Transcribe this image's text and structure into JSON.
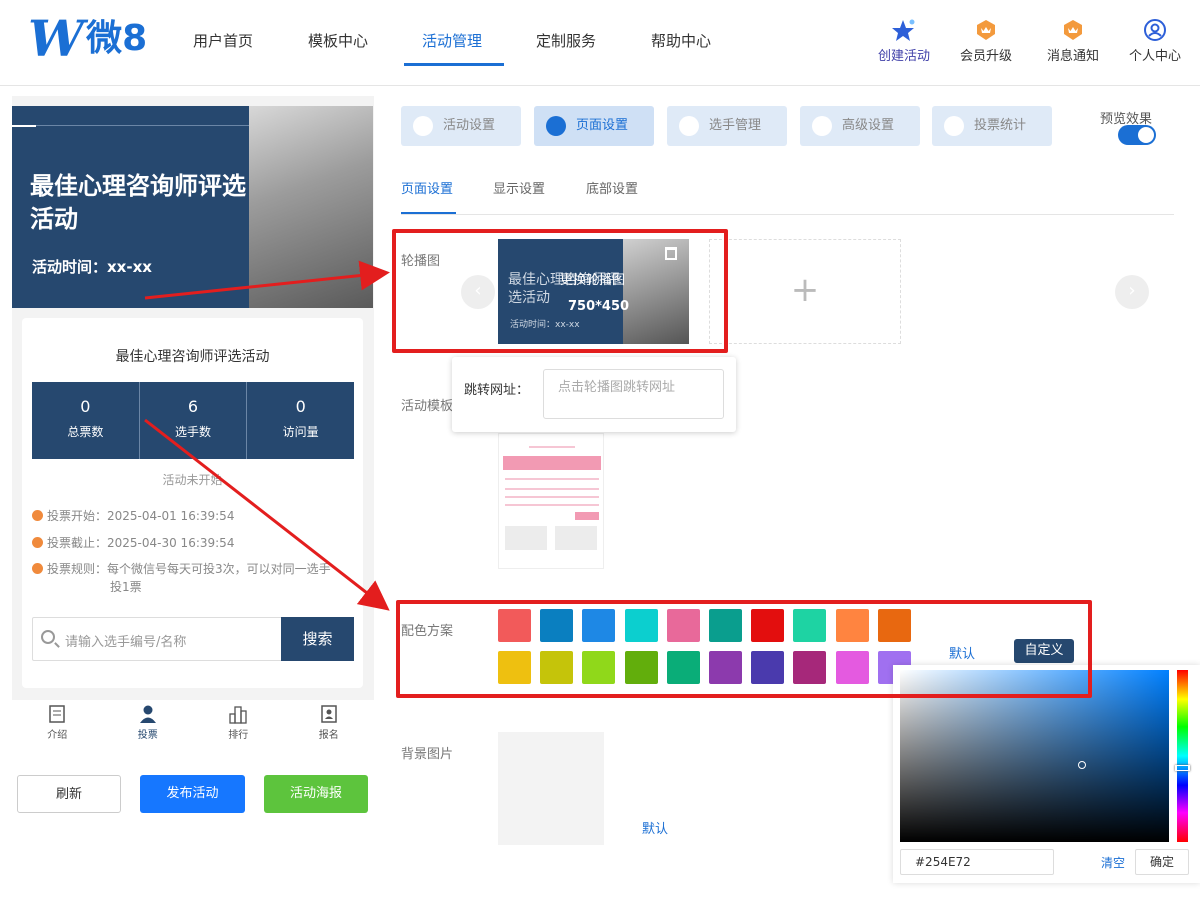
{
  "header": {
    "logo_text": "微8",
    "nav": [
      "用户首页",
      "模板中心",
      "活动管理",
      "定制服务",
      "帮助中心"
    ],
    "right_nav": [
      "创建活动",
      "会员升级",
      "消息通知",
      "个人中心"
    ]
  },
  "preview": {
    "banner_title": "最佳心理咨询师评选活动",
    "banner_time": "活动时间：xx-xx",
    "card_title": "最佳心理咨询师评选活动",
    "stats": [
      {
        "value": "0",
        "label": "总票数"
      },
      {
        "value": "6",
        "label": "选手数"
      },
      {
        "value": "0",
        "label": "访问量"
      }
    ],
    "status": "活动未开始",
    "vote_start": "投票开始：2025-04-01 16:39:54",
    "vote_end": "投票截止：2025-04-30 16:39:54",
    "vote_rule_1": "投票规则：每个微信号每天可投3次，可以对同一选手",
    "vote_rule_2": "投1票",
    "search_placeholder": "请输入选手编号/名称",
    "search_button": "搜索",
    "tabbar": [
      "介绍",
      "投票",
      "排行",
      "报名"
    ],
    "buttons": {
      "refresh": "刷新",
      "publish": "发布活动",
      "poster": "活动海报"
    }
  },
  "settings": {
    "main_tabs": [
      "活动设置",
      "页面设置",
      "选手管理",
      "高级设置",
      "投票统计"
    ],
    "preview_label": "预览效果",
    "preview_toggle_on": true,
    "sub_tabs": [
      "页面设置",
      "显示设置",
      "底部设置"
    ],
    "carousel": {
      "label": "轮播图",
      "slide_text": "最佳心理咨询师评选活动",
      "change_text": "更换轮播图",
      "size_text": "750*450",
      "slide_time": "活动时间：xx-xx",
      "add_icon": "+",
      "prev_icon": "‹",
      "next_icon": "›",
      "jump_label": "跳转网址：",
      "jump_placeholder": "点击轮播图跳转网址"
    },
    "template_label": "活动模板",
    "color": {
      "label": "配色方案",
      "swatches": [
        "#f25a5a",
        "#0a7fc0",
        "#1e88e5",
        "#0ccfcf",
        "#e8699a",
        "#0a9e8e",
        "#e30e0e",
        "#1ed3a3",
        "#ff8440",
        "#e86810",
        "#eec010",
        "#c5c40a",
        "#90d81a",
        "#62ae0c",
        "#0aad78",
        "#8c3aad",
        "#4a3aad",
        "#a6287a",
        "#e45ae0",
        "#a070f0"
      ],
      "default_label": "默认",
      "custom_label": "自定义"
    },
    "picker": {
      "hex": "#254E72",
      "clear": "清空",
      "ok": "确定"
    },
    "background": {
      "label": "背景图片",
      "default_label": "默认"
    }
  }
}
